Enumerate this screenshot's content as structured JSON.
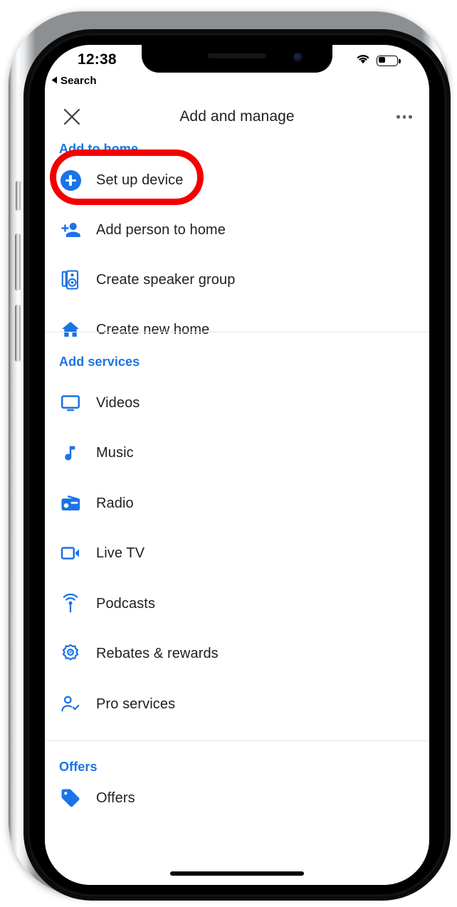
{
  "status_bar": {
    "time": "12:38",
    "back_label": "Search",
    "back_icon": "triangle-left-icon",
    "wifi_icon": "wifi-icon",
    "battery_icon": "battery-low-icon"
  },
  "header": {
    "title": "Add and manage",
    "close_icon": "close-x-icon",
    "more_icon": "more-horizontal-icon"
  },
  "colors": {
    "accent_blue": "#1a73e8",
    "annotation_red": "#f30000",
    "text_primary": "#202124",
    "divider": "#e4e6e9"
  },
  "annotation": {
    "shape": "ellipse",
    "target": "Set up device",
    "color": "#f30000"
  },
  "sections": [
    {
      "title": "Add to home",
      "items": [
        {
          "label": "Set up device",
          "icon": "plus-circle-icon",
          "highlighted": true
        },
        {
          "label": "Add person to home",
          "icon": "person-add-icon",
          "highlighted": false
        },
        {
          "label": "Create speaker group",
          "icon": "speaker-group-icon",
          "highlighted": false
        },
        {
          "label": "Create new home",
          "icon": "home-icon",
          "highlighted": false
        }
      ]
    },
    {
      "title": "Add services",
      "items": [
        {
          "label": "Videos",
          "icon": "tv-monitor-icon",
          "highlighted": false
        },
        {
          "label": "Music",
          "icon": "music-note-icon",
          "highlighted": false
        },
        {
          "label": "Radio",
          "icon": "radio-icon",
          "highlighted": false
        },
        {
          "label": "Live TV",
          "icon": "video-camera-icon",
          "highlighted": false
        },
        {
          "label": "Podcasts",
          "icon": "podcast-icon",
          "highlighted": false
        },
        {
          "label": "Rebates & rewards",
          "icon": "rebate-badge-icon",
          "highlighted": false
        },
        {
          "label": "Pro services",
          "icon": "person-check-icon",
          "highlighted": false
        }
      ]
    },
    {
      "title": "Offers",
      "items": [
        {
          "label": "Offers",
          "icon": "price-tag-icon",
          "highlighted": false
        }
      ]
    }
  ]
}
